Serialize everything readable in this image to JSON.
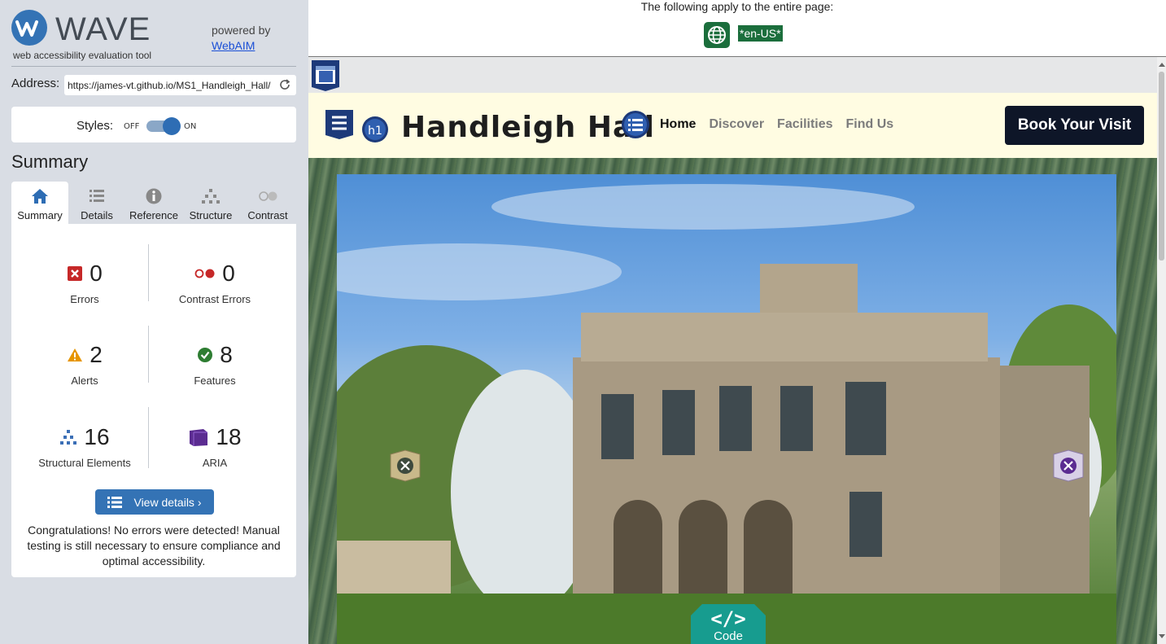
{
  "wave": {
    "logo_text": "WAVE",
    "tagline": "web accessibility evaluation tool",
    "powered_by": "powered by",
    "webaim_link": "WebAIM",
    "address_label": "Address:",
    "address_value": "https://james-vt.github.io/MS1_Handleigh_Hall/",
    "styles_label": "Styles:",
    "styles_off": "OFF",
    "styles_on": "ON",
    "styles_enabled": true,
    "summary_heading": "Summary",
    "tabs": [
      {
        "label": "Summary",
        "icon": "home-icon",
        "active": true
      },
      {
        "label": "Details",
        "icon": "list-icon",
        "active": false
      },
      {
        "label": "Reference",
        "icon": "info-icon",
        "active": false
      },
      {
        "label": "Structure",
        "icon": "hierarchy-icon",
        "active": false
      },
      {
        "label": "Contrast",
        "icon": "contrast-icon",
        "active": false
      }
    ],
    "stats": {
      "errors": {
        "value": "0",
        "label": "Errors",
        "color": "#c62828"
      },
      "contrast_errors": {
        "value": "0",
        "label": "Contrast Errors",
        "color": "#c62828"
      },
      "alerts": {
        "value": "2",
        "label": "Alerts",
        "color": "#e69500"
      },
      "features": {
        "value": "8",
        "label": "Features",
        "color": "#2e7d32"
      },
      "structural": {
        "value": "16",
        "label": "Structural Elements",
        "color": "#3b6fb6"
      },
      "aria": {
        "value": "18",
        "label": "ARIA",
        "color": "#5b2c91"
      }
    },
    "view_details": "View details ›",
    "congrats": "Congratulations! No errors were detected! Manual testing is still necessary to ensure compliance and optimal accessibility."
  },
  "page_notice": {
    "text": "The following apply to the entire page:",
    "language": "*en-US*"
  },
  "site": {
    "title": "Handleigh Hall",
    "nav": [
      {
        "label": "Home",
        "active": true
      },
      {
        "label": "Discover",
        "active": false
      },
      {
        "label": "Facilities",
        "active": false
      },
      {
        "label": "Find Us",
        "active": false
      }
    ],
    "book_button": "Book Your Visit",
    "h1_badge": "h1",
    "code_tab": "Code"
  },
  "colors": {
    "wave_blue": "#3473b5",
    "panel_bg": "#d9dde4",
    "header_bg": "#fffce2",
    "book_btn": "#0e1628",
    "lang_green": "#1b6e3c",
    "code_teal": "#179c8f"
  }
}
